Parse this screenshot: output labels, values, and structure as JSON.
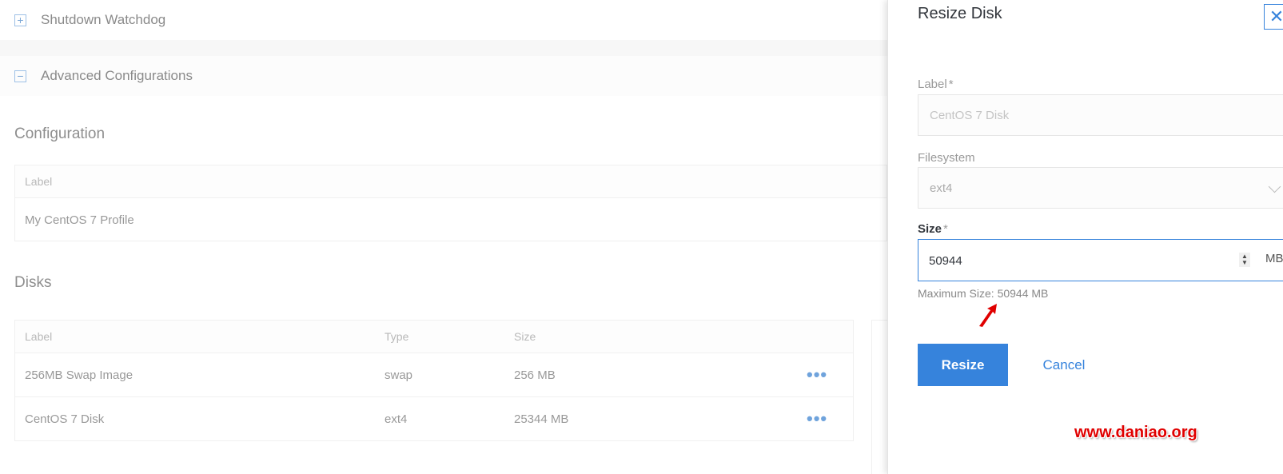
{
  "background": {
    "sections": {
      "shutdown": {
        "toggle": "+",
        "title": "Shutdown Watchdog"
      },
      "advanced": {
        "toggle": "−",
        "title": "Advanced Configurations"
      }
    },
    "configuration": {
      "heading": "Configuration",
      "column_label": "Label",
      "row_value": "My CentOS 7 Profile"
    },
    "disks": {
      "heading": "Disks",
      "columns": {
        "label": "Label",
        "type": "Type",
        "size": "Size"
      },
      "rows": [
        {
          "label": "256MB Swap Image",
          "type": "swap",
          "size": "256 MB",
          "menu": "•••"
        },
        {
          "label": "CentOS 7 Disk",
          "type": "ext4",
          "size": "25344 MB",
          "menu": "•••"
        }
      ]
    }
  },
  "drawer": {
    "title": "Resize Disk",
    "close_icon": "✕",
    "label_field": {
      "label": "Label",
      "required": "*",
      "value": "CentOS 7 Disk"
    },
    "filesystem_field": {
      "label": "Filesystem",
      "value": "ext4"
    },
    "size_field": {
      "label": "Size",
      "required": "*",
      "value": "50944",
      "unit": "MB"
    },
    "helper_text": "Maximum Size: 50944 MB",
    "resize_button": "Resize",
    "cancel_button": "Cancel"
  },
  "watermark": "www.daniao.org",
  "colors": {
    "accent": "#3683dc",
    "watermark": "#e00000"
  }
}
